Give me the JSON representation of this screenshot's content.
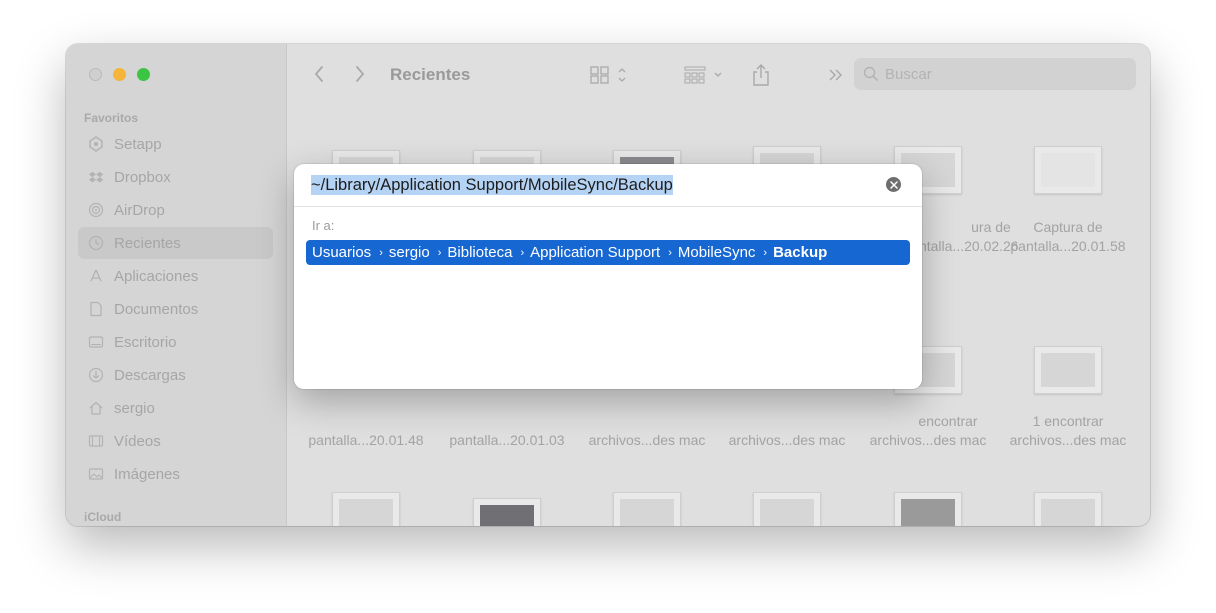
{
  "sidebar": {
    "favorites_label": "Favoritos",
    "icloud_label": "iCloud",
    "items": [
      {
        "label": "Setapp",
        "icon": "setapp-icon"
      },
      {
        "label": "Dropbox",
        "icon": "dropbox-icon"
      },
      {
        "label": "AirDrop",
        "icon": "airdrop-icon"
      },
      {
        "label": "Recientes",
        "icon": "clock-icon"
      },
      {
        "label": "Aplicaciones",
        "icon": "applications-icon"
      },
      {
        "label": "Documentos",
        "icon": "document-icon"
      },
      {
        "label": "Escritorio",
        "icon": "desktop-icon"
      },
      {
        "label": "Descargas",
        "icon": "download-icon"
      },
      {
        "label": "sergio",
        "icon": "home-icon"
      },
      {
        "label": "Vídeos",
        "icon": "film-icon"
      },
      {
        "label": "Imágenes",
        "icon": "photo-icon"
      }
    ],
    "active_item": "Recientes"
  },
  "toolbar": {
    "title": "Recientes",
    "search_placeholder": "Buscar"
  },
  "files": {
    "row1": [
      {
        "line1": "Captura de",
        "line2": "pantalla...20.02.26",
        "visible_prefix": "ura de"
      },
      {
        "line1": "Captura de",
        "line2": "pantalla...20.01.58"
      }
    ],
    "row2": [
      {
        "line1": "",
        "line2": "pantalla...20.01.48"
      },
      {
        "line1": "",
        "line2": "pantalla...20.01.03"
      },
      {
        "line1": "",
        "line2": "archivos...des mac"
      },
      {
        "line1": "",
        "line2": "archivos...des mac"
      },
      {
        "line1": "encontrar",
        "line2": "archivos...des mac"
      },
      {
        "line1": "1 encontrar",
        "line2": "archivos...des mac"
      }
    ]
  },
  "dialog": {
    "path_value": "~/Library/Application Support/MobileSync/Backup",
    "goto_label": "Ir a:",
    "suggestion": [
      "Usuarios",
      "sergio",
      "Biblioteca",
      "Application Support",
      "MobileSync",
      "Backup"
    ]
  },
  "colors": {
    "accent": "#1767d2",
    "selection": "#b4d3f5",
    "traffic_min": "#f5b53a",
    "traffic_zoom": "#3cc445"
  }
}
